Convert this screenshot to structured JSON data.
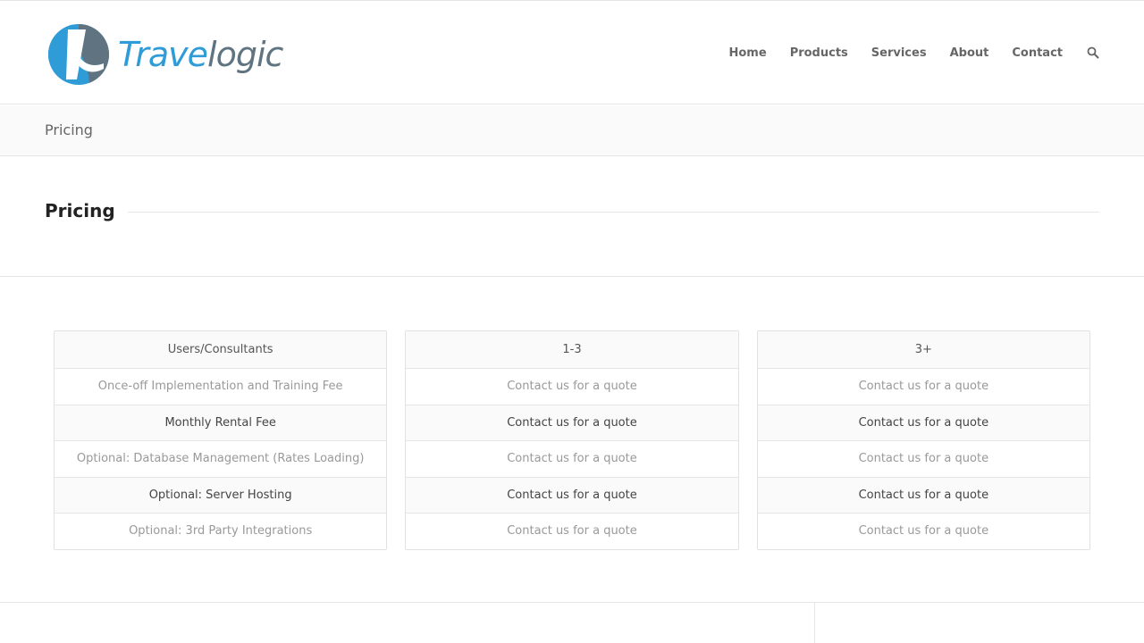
{
  "brand": {
    "name_part1": "Trave",
    "name_part2": "logic",
    "colors": {
      "blue": "#2f9bd7",
      "slate": "#5f7480"
    }
  },
  "nav": {
    "items": [
      {
        "label": "Home"
      },
      {
        "label": "Products"
      },
      {
        "label": "Services"
      },
      {
        "label": "About"
      },
      {
        "label": "Contact"
      }
    ],
    "search_icon": "search-icon"
  },
  "breadcrumb": {
    "title": "Pricing"
  },
  "section": {
    "heading": "Pricing"
  },
  "pricing": {
    "columns": [
      {
        "header": "Users/Consultants",
        "rows": [
          "Once-off Implementation and Training Fee",
          "Monthly Rental Fee",
          "Optional: Database Management (Rates Loading)",
          "Optional: Server Hosting",
          "Optional: 3rd Party Integrations"
        ]
      },
      {
        "header": "1-3",
        "rows": [
          "Contact us for a quote",
          "Contact us for a quote",
          "Contact us for a quote",
          "Contact us for a quote",
          "Contact us for a quote"
        ]
      },
      {
        "header": "3+",
        "rows": [
          "Contact us for a quote",
          "Contact us for a quote",
          "Contact us for a quote",
          "Contact us for a quote",
          "Contact us for a quote"
        ]
      }
    ]
  }
}
